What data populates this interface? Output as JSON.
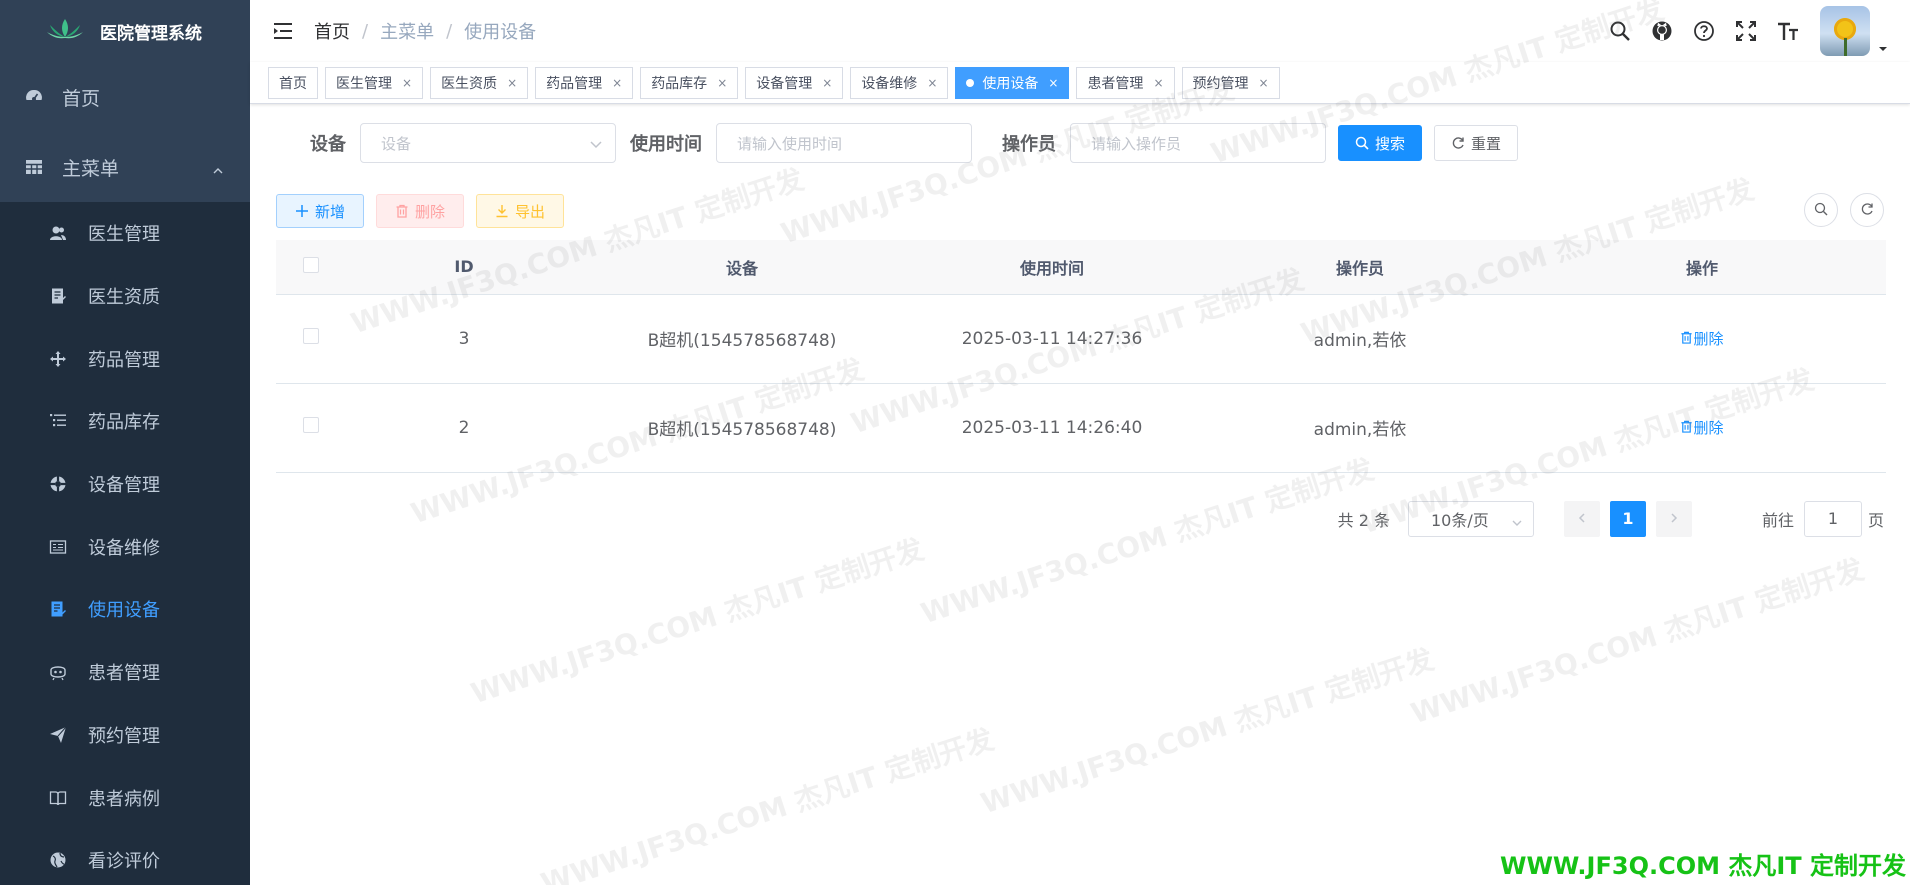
{
  "app": {
    "title": "医院管理系统"
  },
  "sidebar": {
    "home": "首页",
    "main_menu": "主菜单",
    "items": [
      {
        "label": "医生管理"
      },
      {
        "label": "医生资质"
      },
      {
        "label": "药品管理"
      },
      {
        "label": "药品库存"
      },
      {
        "label": "设备管理"
      },
      {
        "label": "设备维修"
      },
      {
        "label": "使用设备"
      },
      {
        "label": "患者管理"
      },
      {
        "label": "预约管理"
      },
      {
        "label": "患者病例"
      },
      {
        "label": "看诊评价"
      }
    ]
  },
  "breadcrumb": {
    "home": "首页",
    "parent": "主菜单",
    "current": "使用设备",
    "sep": "/"
  },
  "tags": [
    {
      "label": "首页"
    },
    {
      "label": "医生管理",
      "close": "×"
    },
    {
      "label": "医生资质",
      "close": "×"
    },
    {
      "label": "药品管理",
      "close": "×"
    },
    {
      "label": "药品库存",
      "close": "×"
    },
    {
      "label": "设备管理",
      "close": "×"
    },
    {
      "label": "设备维修",
      "close": "×"
    },
    {
      "label": "使用设备",
      "close": "×"
    },
    {
      "label": "患者管理",
      "close": "×"
    },
    {
      "label": "预约管理",
      "close": "×"
    }
  ],
  "search": {
    "device_label": "设备",
    "device_placeholder": "设备",
    "time_label": "使用时间",
    "time_placeholder": "请输入使用时间",
    "operator_label": "操作员",
    "operator_placeholder": "请输入操作员",
    "search_btn": "搜索",
    "reset_btn": "重置"
  },
  "actions": {
    "add": "新增",
    "delete": "删除",
    "export": "导出"
  },
  "table": {
    "headers": [
      "ID",
      "设备",
      "使用时间",
      "操作员",
      "操作"
    ],
    "rows": [
      {
        "id": "3",
        "device": "B超机(154578568748)",
        "time": "2025-03-11 14:27:36",
        "operator": "admin,若依",
        "op": "删除"
      },
      {
        "id": "2",
        "device": "B超机(154578568748)",
        "time": "2025-03-11 14:26:40",
        "operator": "admin,若依",
        "op": "删除"
      }
    ]
  },
  "pagination": {
    "total": "共 2 条",
    "page_size": "10条/页",
    "current_page": "1",
    "goto_prefix": "前往",
    "goto_value": "1",
    "goto_suffix": "页"
  },
  "watermark": {
    "text": "WWW.JF3Q.COM 杰凡IT 定制开发",
    "brand": "WWW.JF3Q.COM 杰凡IT  定制开发"
  },
  "colors": {
    "sidebar_bg": "#304156",
    "submenu_bg": "#1f2d3d",
    "primary": "#1890ff",
    "active_menu": "#409eff"
  }
}
